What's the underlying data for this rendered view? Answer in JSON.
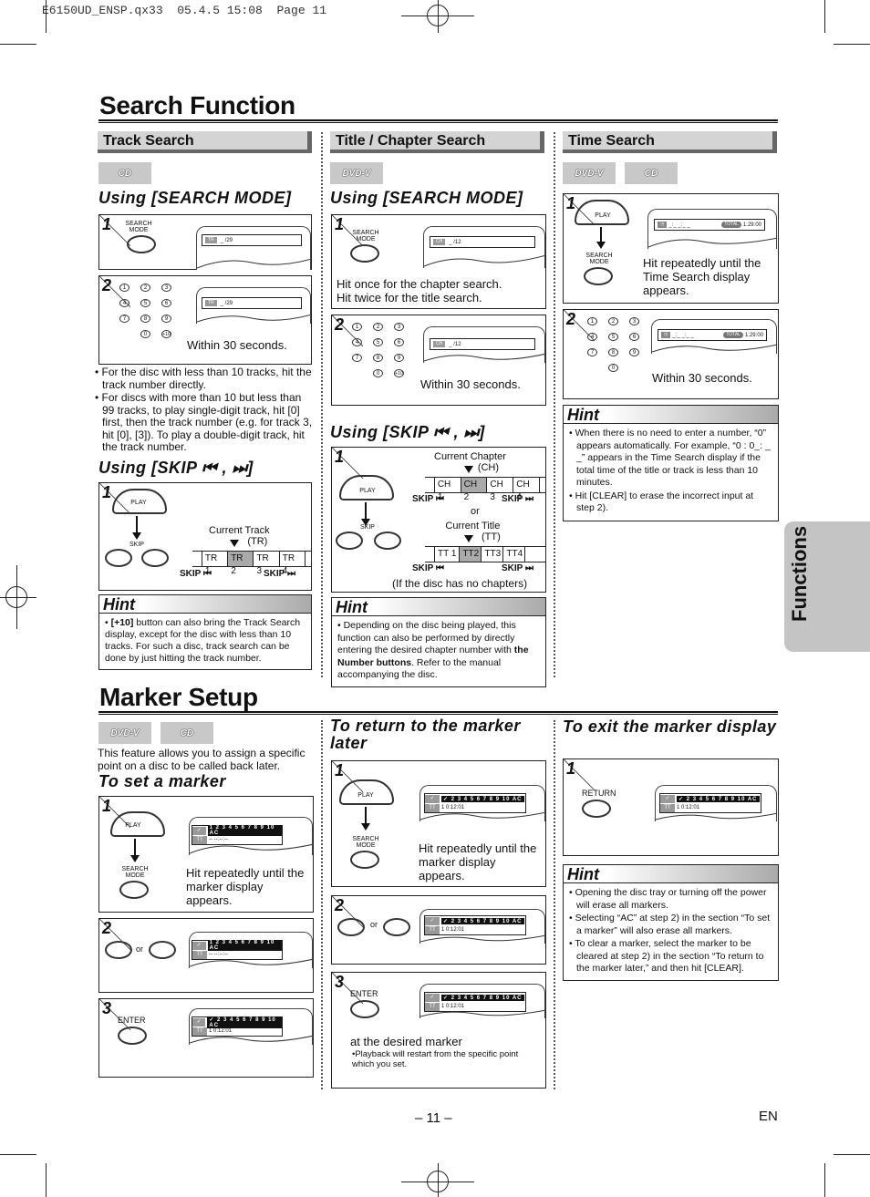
{
  "slug": "E6150UD_ENSP.qx33  05.4.5 15:08  Page 11",
  "search_function": {
    "title": "Search Function",
    "track_search": {
      "header": "Track Search",
      "badges": [
        "CD"
      ],
      "using_search_mode": "Using [SEARCH MODE]",
      "step1": {
        "button": "SEARCH MODE",
        "display_tag": "TR",
        "display_value": "_ /29"
      },
      "step2": {
        "keys": [
          "1",
          "2",
          "3",
          "4",
          "5",
          "6",
          "7",
          "8",
          "9",
          "0",
          "+10"
        ],
        "display_tag": "TR",
        "display_value": "_ /29",
        "caption": "Within 30 seconds."
      },
      "notes": [
        "For the disc with less than 10 tracks, hit the track number directly.",
        "For discs with more than 10 but less than 99 tracks, to play single-digit track, hit [0] first, then the track number (e.g. for track 3, hit [0], [3]). To play a double-digit track, hit the track number."
      ],
      "using_skip": "Using [SKIP ⏮ , ⏭]",
      "skip_step1": {
        "play_label": "PLAY",
        "skip_label": "SKIP",
        "current_label": "Current Track",
        "current_abbr": "(TR)",
        "items": [
          "TR 1",
          "TR 2",
          "TR 3",
          "TR 4"
        ],
        "active_index": 1,
        "skip_back": "SKIP ⏮",
        "skip_fwd": "SKIP ⏭"
      },
      "hint_title": "Hint",
      "hint_prefix": "[+10]",
      "hint_text": " button can also bring the Track Search display, except for the disc with less than 10 tracks.  For such a disc, track search can be done by just hitting the track number."
    },
    "title_chapter_search": {
      "header": "Title / Chapter Search",
      "badges": [
        "DVD-V"
      ],
      "using_search_mode": "Using [SEARCH MODE]",
      "step1": {
        "button": "SEARCH MODE",
        "display_tag": "CH",
        "display_value": "_ /12",
        "caption1": "Hit once for the chapter search.",
        "caption2": "Hit twice for the title search."
      },
      "step2": {
        "keys": [
          "1",
          "2",
          "3",
          "4",
          "5",
          "6",
          "7",
          "8",
          "9",
          "0",
          "+10"
        ],
        "display_tag": "CH",
        "display_value": "_ /12",
        "caption": "Within 30 seconds."
      },
      "using_skip": "Using [SKIP ⏮ , ⏭]",
      "skip_step1": {
        "play_label": "PLAY",
        "skip_label": "SKIP",
        "chapter_label": "Current Chapter",
        "chapter_abbr": "(CH)",
        "chapters": [
          "CH 1",
          "CH 2",
          "CH 3",
          "CH 4"
        ],
        "chapter_active": 1,
        "or": "or",
        "title_label": "Current Title",
        "title_abbr": "(TT)",
        "titles": [
          "TT 1",
          "TT2",
          "TT3",
          "TT4"
        ],
        "title_active": 1,
        "skip_back": "SKIP ⏮",
        "skip_fwd": "SKIP ⏭",
        "note": "(If the disc has no chapters)"
      },
      "hint_title": "Hint",
      "hint_text_a": "Depending on the disc being played, this function can also be performed by directly entering the desired chapter number with ",
      "hint_bold": "the Number buttons",
      "hint_text_b": ". Refer to the manual accompanying the disc."
    },
    "time_search": {
      "header": "Time Search",
      "badges": [
        "DVD-V",
        "CD"
      ],
      "step1": {
        "play_label": "PLAY",
        "button": "SEARCH MODE",
        "display_value": "_:_ _:_ _",
        "total_tag": "TOTAL",
        "total": "1:29:00",
        "caption": "Hit repeatedly until the Time Search display appears."
      },
      "step2": {
        "keys": [
          "1",
          "2",
          "3",
          "4",
          "5",
          "6",
          "7",
          "8",
          "9",
          "0"
        ],
        "display_value": "_:_ _:_ _",
        "total_tag": "TOTAL",
        "total": "1:29:00",
        "caption": "Within 30 seconds."
      },
      "hint_title": "Hint",
      "hint_items": [
        "When there is no need to enter a number, “0” appears automatically. For example, “0 : 0_: _ _” appears in the Time Search display if the total time of the title or track is less than 10 minutes.",
        "Hit [CLEAR] to erase the incorrect input at step 2)."
      ]
    }
  },
  "marker_setup": {
    "title": "Marker Setup",
    "badges": [
      "DVD-V",
      "CD"
    ],
    "intro": "This feature allows you to assign a specific point on a disc to be called back later.",
    "set_marker": {
      "heading": "To set a marker",
      "step1": {
        "play_label": "PLAY",
        "button": "SEARCH MODE",
        "digits": "1 2 3 4 5 6 7 8 9 10 AC",
        "row2": "-- --:--:--",
        "caption": "Hit repeatedly until the marker display appears."
      },
      "step2": {
        "or": "or",
        "digits": "1 2 3 4 5 6 7 8 9 10 AC",
        "row2": "-- --:--:--"
      },
      "step3": {
        "button": "ENTER",
        "digits": "✓ 2 3 4 5 6 7 8 9 10 AC",
        "row2": "1  0:12:01"
      }
    },
    "return_marker": {
      "heading": "To return to the marker later",
      "step1": {
        "play_label": "PLAY",
        "button": "SEARCH MODE",
        "digits": "✓ 2 3 4 5 6 7 8 9 10 AC",
        "row2": "1  0:12:01",
        "caption": "Hit repeatedly until the marker display appears."
      },
      "step2": {
        "or": "or",
        "digits": "✓ 2 3 4 5 6 7 8 9 10 AC",
        "row2": "1  0:12:01"
      },
      "step3": {
        "button": "ENTER",
        "digits": "✓ 2 3 4 5 6 7 8 9 10 AC",
        "row2": "1  0:12:01",
        "caption": "at the desired marker",
        "note": "•Playback will restart from the specific point which you set."
      }
    },
    "exit_marker": {
      "heading": "To exit the marker display",
      "step1": {
        "button": "RETURN",
        "digits": "✓ 2 3 4 5 6 7 8 9 10 AC",
        "row2": "1  0:12:01"
      },
      "hint_title": "Hint",
      "hint_items": [
        "Opening the disc tray or turning off the power will erase all markers.",
        "Selecting “AC” at step 2) in the section “To set a marker” will also erase all markers.",
        "To clear a marker, select the marker to be cleared at step 2) in the section “To return to the marker later,” and then hit [CLEAR]."
      ]
    }
  },
  "side_tab": "Functions",
  "page_number": "– 11 –",
  "language": "EN"
}
